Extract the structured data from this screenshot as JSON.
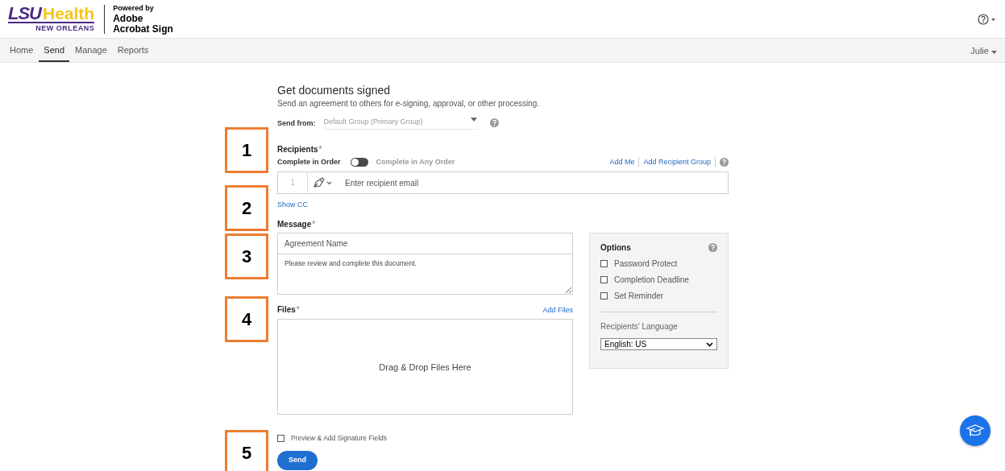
{
  "header": {
    "logo": {
      "lsu": "LSU",
      "health": "Health",
      "city": "NEW ORLEANS"
    },
    "powered_by": "Powered by",
    "product": [
      "Adobe",
      "Acrobat Sign"
    ]
  },
  "nav": {
    "tabs": [
      {
        "label": "Home",
        "selected": false
      },
      {
        "label": "Send",
        "selected": true
      },
      {
        "label": "Manage",
        "selected": false
      },
      {
        "label": "Reports",
        "selected": false
      }
    ],
    "user": "Julie"
  },
  "form": {
    "title": "Get documents signed",
    "subtitle": "Send an agreement to others for e-signing, approval, or other processing.",
    "send_from": {
      "label": "Send from:",
      "value": "Default Group (Primary Group)"
    },
    "recipients": {
      "label": "Recipients",
      "required": "*",
      "order_label": "Complete in Order",
      "any_order_label": "Complete in Any Order",
      "any_order_on": false,
      "links": [
        "Add Me",
        "Add Recipient Group"
      ],
      "rows": [
        {
          "number": "1",
          "placeholder": "Enter recipient email"
        }
      ],
      "show_cc": "Show CC"
    },
    "message": {
      "label": "Message",
      "required": "*",
      "name_placeholder": "Agreement Name",
      "body": "Please review and complete this document."
    },
    "files": {
      "label": "Files",
      "required": "*",
      "add": "Add Files",
      "drop": "Drag & Drop Files Here"
    },
    "options": {
      "title": "Options",
      "items": [
        {
          "label": "Password Protect",
          "checked": false
        },
        {
          "label": "Completion Deadline",
          "checked": false
        },
        {
          "label": "Set Reminder",
          "checked": false
        }
      ],
      "language_label": "Recipients' Language",
      "language": "English: US"
    },
    "preview": {
      "label": "Preview & Add Signature Fields",
      "checked": false
    },
    "send": "Send"
  },
  "callouts": [
    "1",
    "2",
    "3",
    "4",
    "5"
  ]
}
